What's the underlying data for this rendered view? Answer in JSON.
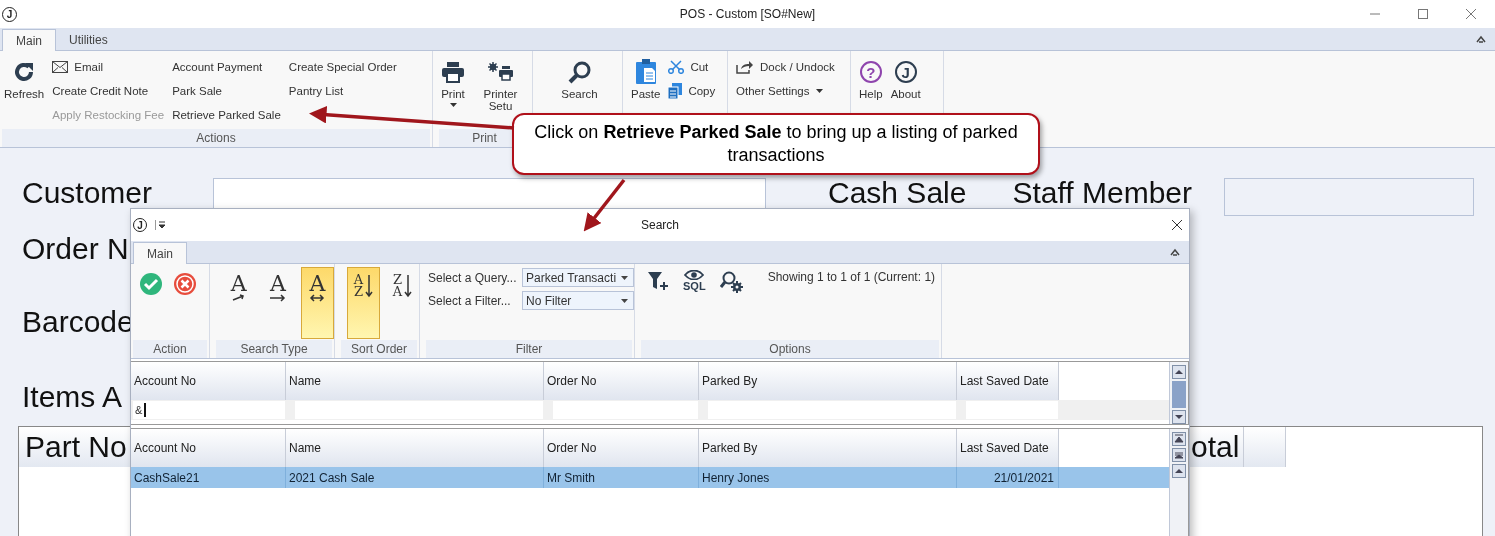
{
  "window": {
    "logo": "J",
    "title": "POS - Custom [SO#New]"
  },
  "ribbon": {
    "tabs": [
      {
        "label": "Main",
        "selected": true
      },
      {
        "label": "Utilities",
        "selected": false
      }
    ],
    "actions": {
      "label": "Actions",
      "refresh": "Refresh",
      "commands": [
        {
          "label": "Email",
          "disabled": false
        },
        {
          "label": "Create Credit Note",
          "disabled": false
        },
        {
          "label": "Apply Restocking Fee",
          "disabled": true
        },
        {
          "label": "Account Payment",
          "disabled": false
        },
        {
          "label": "Park Sale",
          "disabled": false
        },
        {
          "label": "Retrieve Parked Sale",
          "disabled": false
        },
        {
          "label": "Create Special Order",
          "disabled": false
        },
        {
          "label": "Pantry List",
          "disabled": false
        }
      ]
    },
    "print": {
      "label": "Print",
      "print": "Print",
      "printer_setup": "Printer Setu"
    },
    "search": "Search",
    "clipboard": {
      "paste": "Paste",
      "cut": "Cut",
      "copy": "Copy"
    },
    "settings": {
      "dock": "Dock / Undock",
      "other": "Other Settings"
    },
    "help": {
      "help_glyph": "?",
      "help": "Help",
      "about_glyph": "J",
      "about": "About"
    }
  },
  "form": {
    "customer_label": "Customer",
    "cash_sale": "Cash Sale",
    "staff_label": "Staff Member",
    "order_label": "Order N",
    "barcode_label": "Barcode",
    "items_label": "Items A",
    "columns": [
      "Part No",
      "otal"
    ]
  },
  "callout": {
    "text": "Click on **Retrieve Parked Sale** to bring up a listing of parked transactions"
  },
  "search_dialog": {
    "logo": "J",
    "title": "Search",
    "tabs": [
      {
        "label": "Main",
        "selected": true
      }
    ],
    "action": {
      "label": "Action"
    },
    "search_type": {
      "label": "Search Type",
      "options": [
        {
          "glyph": "A",
          "selected": false
        },
        {
          "glyph": "A",
          "selected": false
        },
        {
          "glyph": "A",
          "selected": true
        }
      ]
    },
    "sort_order": {
      "label": "Sort Order",
      "options": [
        {
          "top": "A",
          "bottom": "Z",
          "selected": true
        },
        {
          "top": "Z",
          "bottom": "A",
          "selected": false
        }
      ]
    },
    "filter": {
      "label": "Filter",
      "query_label": "Select a Query...",
      "query_value": "Parked Transacti",
      "filter_label": "Select a Filter...",
      "filter_value": "No Filter"
    },
    "options": {
      "label": "Options",
      "sql_caption": "SQL",
      "status": "Showing 1 to 1 of 1 (Current: 1)"
    },
    "filter_grid": {
      "columns": [
        "Account No",
        "Name",
        "Order No",
        "Parked By",
        "Last Saved Date"
      ],
      "filter_text": "&"
    },
    "results_grid": {
      "columns": [
        "Account No",
        "Name",
        "Order No",
        "Parked By",
        "Last Saved Date"
      ],
      "rows": [
        {
          "cells": [
            "CashSale21",
            "2021 Cash Sale",
            "Mr Smith",
            "Henry Jones",
            "21/01/2021"
          ],
          "selected": true
        }
      ]
    }
  }
}
